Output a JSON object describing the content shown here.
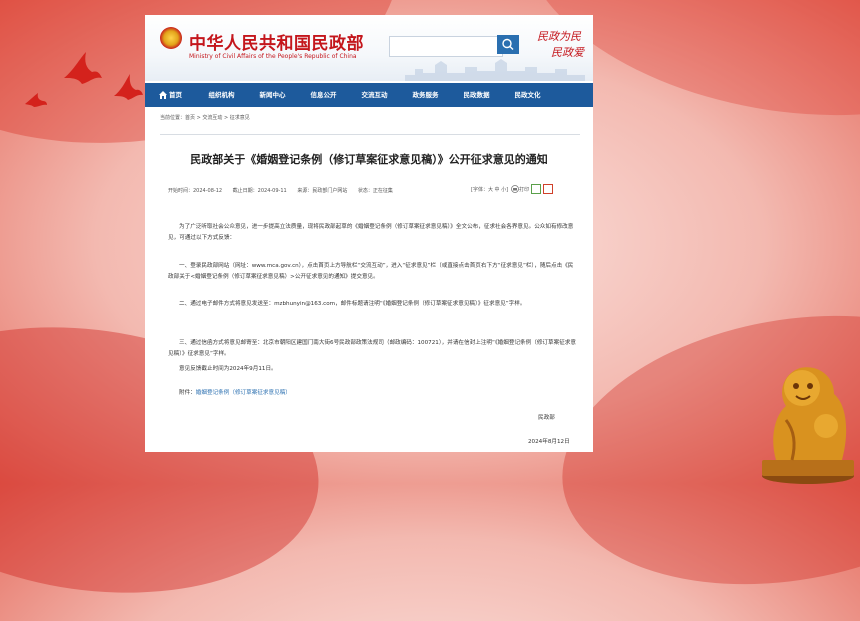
{
  "site": {
    "name_cn": "中华人民共和国民政部",
    "name_en": "Ministry of Civil Affairs of the People's Republic of China",
    "calligraphy": [
      "民政为民",
      "民政爱"
    ],
    "search_placeholder": ""
  },
  "nav": {
    "items": [
      {
        "label": "首页"
      },
      {
        "label": "组织机构"
      },
      {
        "label": "新闻中心"
      },
      {
        "label": "信息公开"
      },
      {
        "label": "交流互动"
      },
      {
        "label": "政务服务"
      },
      {
        "label": "民政数据"
      },
      {
        "label": "民政文化"
      }
    ]
  },
  "breadcrumb": "当前位置：首页 > 交流互动 > 征求意见",
  "article": {
    "title": "民政部关于《婚姻登记条例（修订草案征求意见稿）》公开征求意见的通知",
    "meta": {
      "start": "开始时间：2024-08-12",
      "end": "截止日期：2024-09-11",
      "source": "来源：民政部门户网站",
      "status": "状态：正在征集"
    },
    "tools": {
      "font_size": "[字体：大 中 小]",
      "print": "打印"
    },
    "paragraphs": {
      "p1": "为了广泛听取社会公众意见，进一步提高立法质量，现将民政部起草的《婚姻登记条例（修订草案征求意见稿）》全文公布，征求社会各界意见。公众如有修改意见，可通过以下方式反馈：",
      "p2": "一、登录民政部网站（网址：www.mca.gov.cn），点击首页上方导航栏“交流互动”，进入“征求意见”栏（或直接点击首页右下方“征求意见”栏），随后点击《民政部关于<婚姻登记条例（修订草案征求意见稿）>公开征求意见的通知》提交意见。",
      "p3": "二、通过电子邮件方式将意见发送至：mzbhunyin@163.com，邮件标题请注明“《婚姻登记条例（修订草案征求意见稿）》征求意见”字样。",
      "p4": "三、通过信函方式将意见邮寄至：北京市朝阳区建国门南大街6号民政部政策法规司（邮政编码：100721），并请在信封上注明“《婚姻登记条例（修订草案征求意见稿）》征求意见”字样。",
      "p5": "意见反馈截止时间为2024年9月11日。",
      "attachment_label": "附件：",
      "attachment_link": "婚姻登记条例（修订草案征求意见稿）"
    },
    "signature": "民政部",
    "date": "2024年8月12日"
  },
  "colors": {
    "nav_blue": "#1d5a9c",
    "brand_red": "#c4161c",
    "link_blue": "#2a6fb0"
  }
}
